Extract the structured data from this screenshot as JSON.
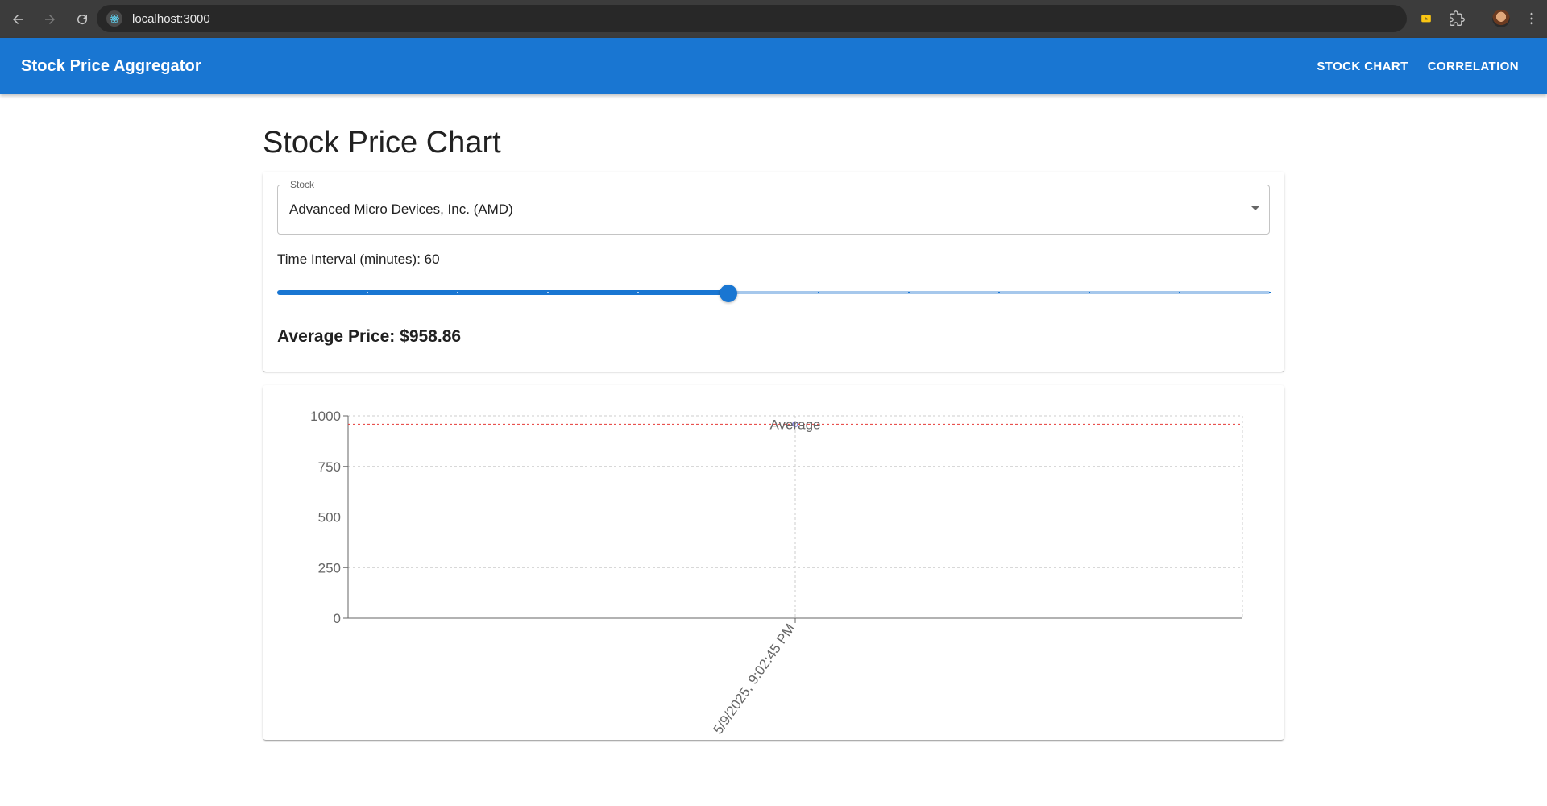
{
  "browser": {
    "url": "localhost:3000",
    "icons": [
      "back-icon",
      "forward-icon",
      "reload-icon",
      "site-info-icon",
      "extension-badge-icon",
      "puzzle-extensions-icon",
      "profile-avatar",
      "kebab-menu-icon"
    ]
  },
  "appbar": {
    "title": "Stock Price Aggregator",
    "nav": [
      {
        "label": "STOCK CHART"
      },
      {
        "label": "CORRELATION"
      }
    ],
    "color": "#1976d2"
  },
  "page": {
    "title": "Stock Price Chart"
  },
  "controls": {
    "stock_label": "Stock",
    "stock_value": "Advanced Micro Devices, Inc. (AMD)",
    "interval_label": "Time Interval (minutes): 60",
    "slider": {
      "value": 60,
      "min": 10,
      "max": 120,
      "step": 10,
      "fraction": 0.4545
    },
    "average_text": "Average Price: $958.86"
  },
  "chart_data": {
    "type": "line",
    "x": [
      "5/9/2025, 9:02:45 PM"
    ],
    "series": [
      {
        "values": [
          958.86
        ],
        "color": "#8884d8"
      }
    ],
    "reference_line": {
      "value": 958.86,
      "label": "Average",
      "color": "#e53935"
    },
    "ylim": [
      0,
      1000
    ],
    "yticks": [
      0,
      250,
      500,
      750,
      1000
    ],
    "grid": true
  }
}
